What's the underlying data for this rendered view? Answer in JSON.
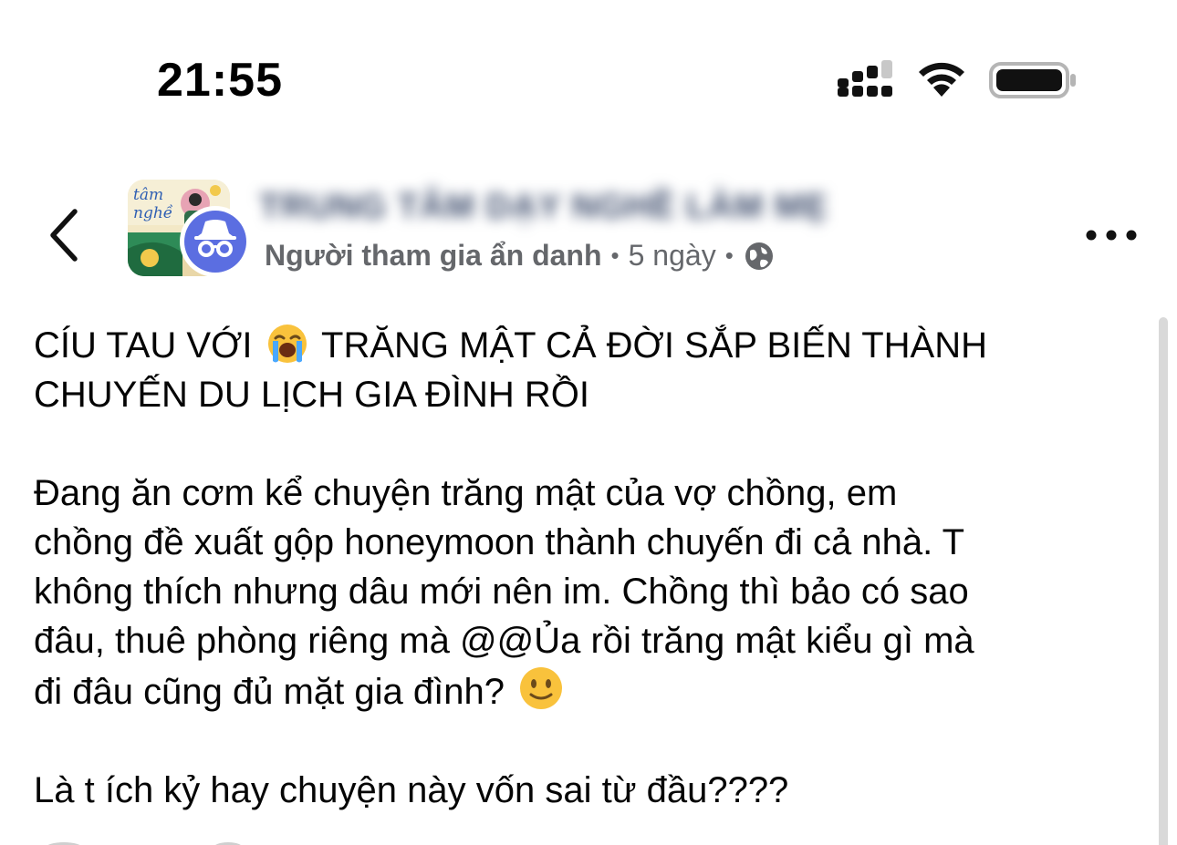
{
  "status_bar": {
    "time": "21:55",
    "icons": [
      "cellular-signal-icon",
      "wifi-icon",
      "battery-icon"
    ]
  },
  "header": {
    "back_icon": "chevron-left-icon",
    "group_avatar_text": "tâm nghề",
    "group_name": "TRUNG TÂM DẠY NGHỀ LÀM MẸ",
    "author": "Người tham gia ẩn danh",
    "separator": "•",
    "time_ago": "5 ngày",
    "audience_icon": "globe-icon",
    "more_icon": "more-horizontal-icon"
  },
  "post": {
    "title_line1_a": "CÍU TAU VỚI",
    "title_emoji": "loudly-crying-face-emoji",
    "title_line1_b": "TRĂNG MẬT CẢ ĐỜI SẮP BIẾN THÀNH",
    "title_line2": "CHUYẾN DU LỊCH GIA ĐÌNH RỒI",
    "body_line1": "Đang ăn cơm kể chuyện trăng mật của vợ chồng, em",
    "body_line2": "chồng đề xuất gộp honeymoon thành chuyến đi cả nhà. T",
    "body_line3": "không thích nhưng dâu mới nên im. Chồng thì bảo có sao",
    "body_line4": "đâu, thuê phòng riêng mà @@Ủa rồi trăng mật kiểu gì mà",
    "body_line5": "đi đâu cũng đủ mặt gia đình?",
    "body_emoji": "slightly-smiling-face-emoji",
    "question": "Là t ích kỷ hay chuyện này vốn sai từ đầu????"
  },
  "colors": {
    "text": "#050505",
    "meta": "#65676b",
    "anon_badge": "#5b6ee1"
  }
}
